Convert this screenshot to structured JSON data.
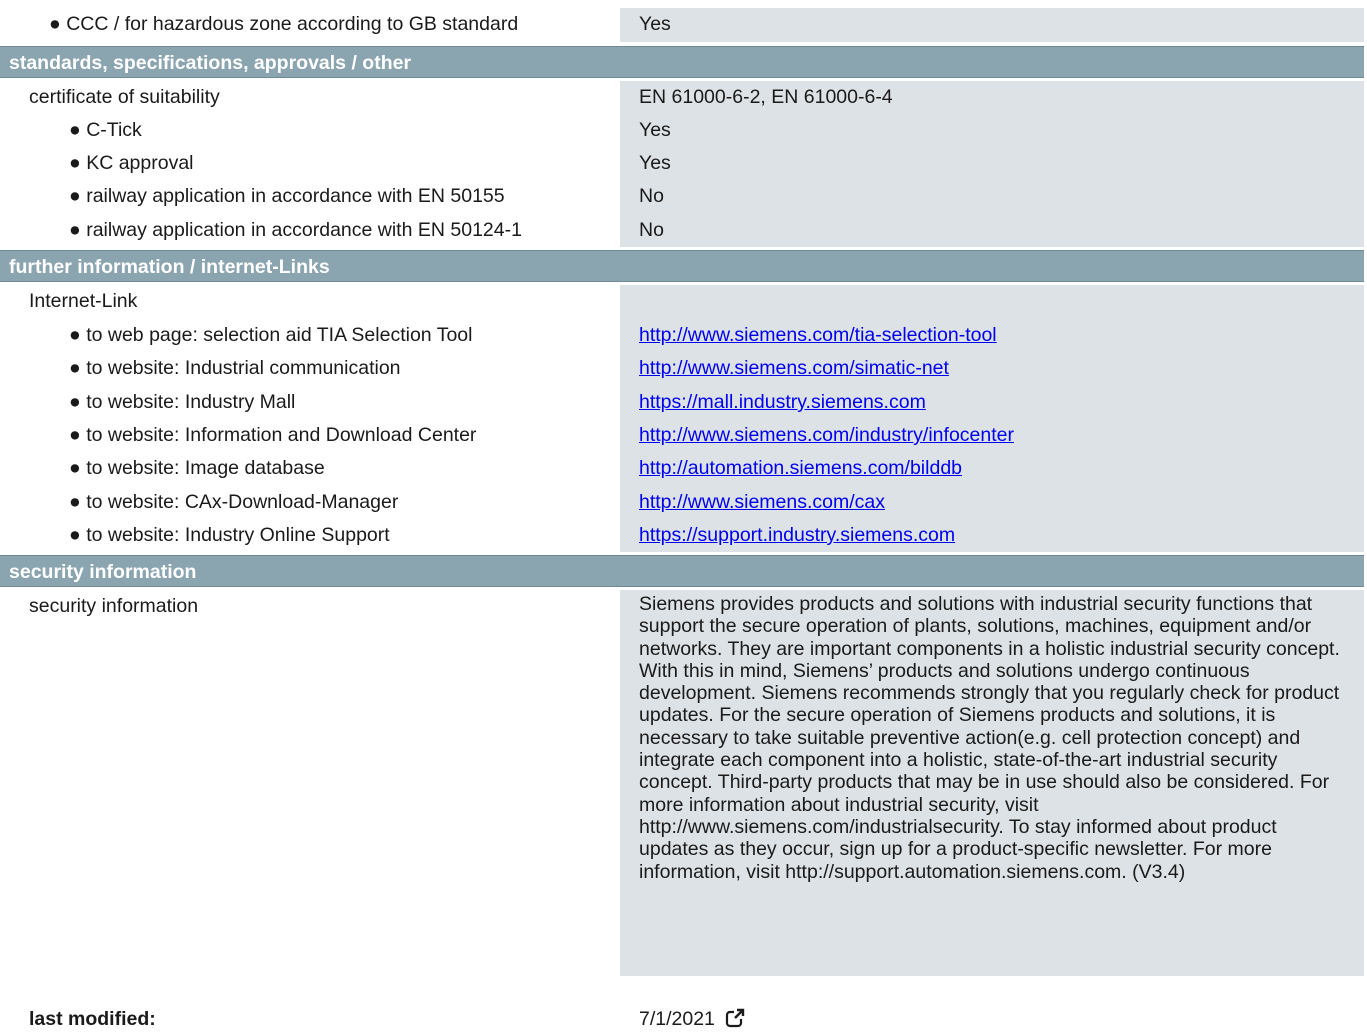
{
  "top_row": {
    "label": "● CCC / for hazardous zone according to GB standard",
    "value": "Yes"
  },
  "sections": {
    "standards": {
      "header": "standards, specifications, approvals / other",
      "certificate": {
        "label": "certificate of suitability",
        "value": "EN 61000-6-2, EN 61000-6-4"
      },
      "items": [
        {
          "label": "● C-Tick",
          "value": "Yes"
        },
        {
          "label": "● KC approval",
          "value": "Yes"
        },
        {
          "label": "● railway application in accordance with EN 50155",
          "value": "No"
        },
        {
          "label": "● railway application in accordance with EN 50124-1",
          "value": "No"
        }
      ]
    },
    "further": {
      "header": "further information / internet-Links",
      "internet_link_label": "Internet-Link",
      "links": [
        {
          "label": "● to web page: selection aid TIA Selection Tool",
          "url": "http://www.siemens.com/tia-selection-tool"
        },
        {
          "label": "● to website: Industrial communication",
          "url": "http://www.siemens.com/simatic-net"
        },
        {
          "label": "● to website: Industry Mall",
          "url": "https://mall.industry.siemens.com"
        },
        {
          "label": "● to website: Information and Download Center",
          "url": "http://www.siemens.com/industry/infocenter"
        },
        {
          "label": "● to website: Image database",
          "url": "http://automation.siemens.com/bilddb"
        },
        {
          "label": "● to website: CAx-Download-Manager",
          "url": "http://www.siemens.com/cax"
        },
        {
          "label": "● to website: Industry Online Support",
          "url": "https://support.industry.siemens.com"
        }
      ]
    },
    "security": {
      "header": "security information",
      "label": "security information",
      "text": "Siemens provides products and solutions with industrial security functions that support the secure operation of plants, solutions, machines, equipment and/or networks. They are important components in a holistic industrial security concept. With this in mind, Siemens’ products and solutions undergo continuous development. Siemens recommends strongly that you regularly check for product updates. For the secure operation of Siemens products and solutions, it is necessary to take suitable preventive action(e.g. cell protection concept) and integrate each component into a holistic, state-of-the-art industrial security concept. Third-party products that may be in use should also be considered. For more information about industrial security, visit http://www.siemens.com/industrialsecurity. To stay informed about product updates as they occur, sign up for a product-specific newsletter. For more information, visit http://support.automation.siemens.com. (V3.4)"
    }
  },
  "footer": {
    "label": "last modified:",
    "date": "7/1/2021",
    "icon": "external-link-icon"
  },
  "colors": {
    "section_header_bg": "#8aa4b0",
    "value_bg": "#dde2e6",
    "link": "#0000ee"
  }
}
